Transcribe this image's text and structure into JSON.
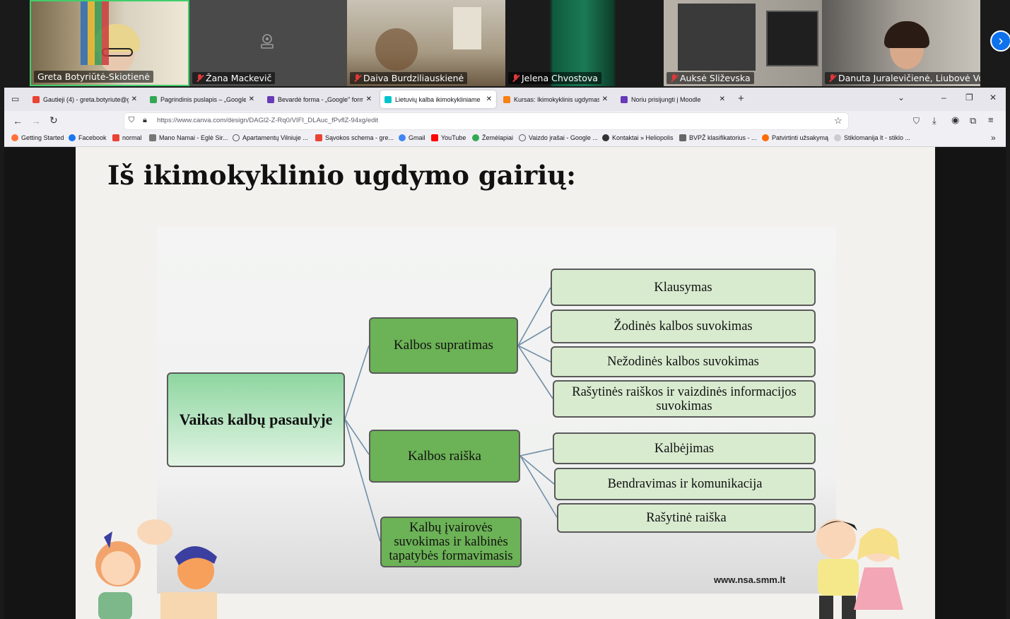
{
  "meeting": {
    "participants": [
      {
        "name": "Greta Botyriūtė-Skiotienė",
        "muted": false
      },
      {
        "name": "Žana Mackevič",
        "muted": true
      },
      {
        "name": "Daiva Burdziliauskienė",
        "muted": true
      },
      {
        "name": "Jelena Chvostova",
        "muted": true
      },
      {
        "name": "Auksė Sliževska",
        "muted": true
      },
      {
        "name": "Danuta Juralevičienė, Liubovė Vo...",
        "muted": true
      }
    ],
    "next_icon": "chevron-right-icon"
  },
  "browser": {
    "tabs": [
      {
        "label": "Gautieji (4) - greta.botyriute@g",
        "color": "#ea4335"
      },
      {
        "label": "Pagrindinis puslapis – „Google",
        "color": "#34a853"
      },
      {
        "label": "Bevardė forma - „Google\" form",
        "color": "#673ab7"
      },
      {
        "label": "Lietuvių kalba ikimokykliniame",
        "color": "#00c4cc"
      },
      {
        "label": "Kursas: Ikimokyklinis ugdymas (",
        "color": "#f98012"
      },
      {
        "label": "Noriu prisijungti į Moodle",
        "color": "#673ab7"
      }
    ],
    "url": "https://www.canva.com/design/DAGl2-Z-Rq0/VIFI_DLAuc_fPvflZ-94xg/edit",
    "bookmarks": [
      "Getting Started",
      "Facebook",
      "normal",
      "Mano Namai - Eglė Sir...",
      "Apartamentų Vilniuje ...",
      "Sąvokos schema - gre...",
      "Gmail",
      "YouTube",
      "Žemėlapiai",
      "Vaizdo įrašai - Google ...",
      "Kontaktai » Heliopolis",
      "BVPŽ klasifikatorius - ...",
      "Patvirtinti užsakymą",
      "Stiklomanija lt - stiklo ..."
    ]
  },
  "slide": {
    "title": "Iš ikimokyklinio ugdymo gairių:",
    "diagram": {
      "root": "Vaikas kalbų pasaulyje",
      "branches": [
        {
          "label": "Kalbos supratimas",
          "children": [
            "Klausymas",
            "Žodinės kalbos suvokimas",
            "Nežodinės kalbos suvokimas",
            "Rašytinės raiškos ir vaizdinės informacijos suvokimas"
          ]
        },
        {
          "label": "Kalbos raiška",
          "children": [
            "Kalbėjimas",
            "Bendravimas ir komunikacija",
            "Rašytinė raiška"
          ]
        },
        {
          "label": "Kalbų įvairovės suvokimas ir kalbinės tapatybės formavimasis",
          "children": []
        }
      ],
      "source": "www.nsa.smm.lt"
    }
  }
}
